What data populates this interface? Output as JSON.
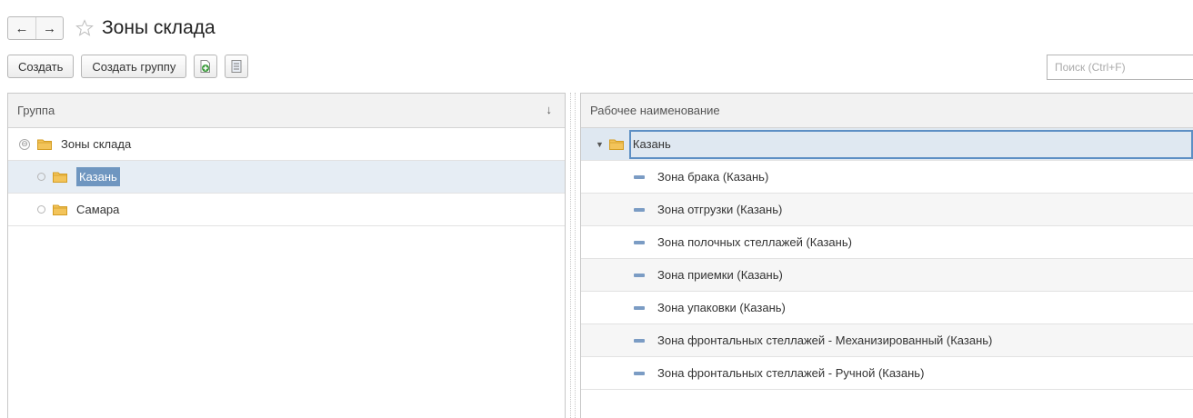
{
  "window": {
    "title": "Зоны склада",
    "back_icon": "arrow-left-icon",
    "forward_icon": "arrow-right-icon",
    "favorite_icon": "star-outline-icon"
  },
  "toolbar": {
    "create_label": "Создать",
    "create_group_label": "Создать группу",
    "add_copy_icon": "add-document-icon",
    "list_icon": "list-view-icon"
  },
  "search": {
    "placeholder": "Поиск (Ctrl+F)"
  },
  "left_panel": {
    "column_header": "Группа",
    "sort_indicator": "↓",
    "rows": [
      {
        "label": "Зоны склада",
        "toggle": "⊖"
      },
      {
        "label": "Казань"
      },
      {
        "label": "Самара"
      }
    ]
  },
  "right_panel": {
    "column_header": "Рабочее наименование",
    "group_row": {
      "label": "Казань",
      "expand": "▼"
    },
    "items": [
      "Зона брака (Казань)",
      "Зона отгрузки (Казань)",
      "Зона полочных стеллажей (Казань)",
      "Зона приемки (Казань)",
      "Зона упаковки (Казань)",
      "Зона фронтальных стеллажей - Механизированный (Казань)",
      "Зона фронтальных стеллажей - Ручной (Казань)"
    ]
  },
  "colors": {
    "selection": "#6f96c0",
    "folder": "#f3c45a",
    "leaf_icon": "#7b9cc4"
  }
}
